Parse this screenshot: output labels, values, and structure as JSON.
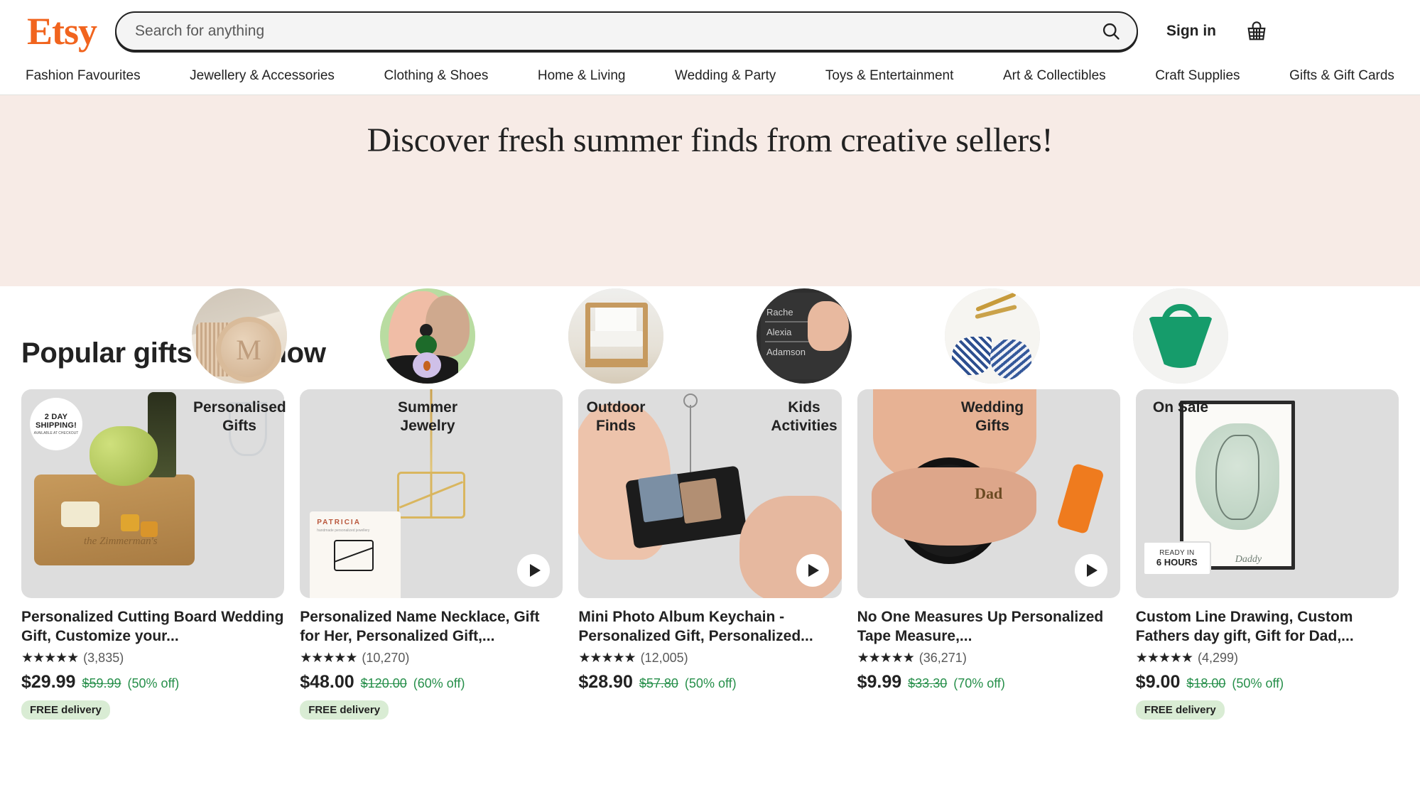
{
  "header": {
    "logo_text": "Etsy",
    "search_placeholder": "Search for anything",
    "search_value": "",
    "search_icon": "search-icon",
    "signin_label": "Sign in",
    "cart_icon": "shopping-basket-icon",
    "brand_color": "#f1641e"
  },
  "nav": {
    "items": [
      {
        "label": "Fashion Favourites"
      },
      {
        "label": "Jewellery & Accessories"
      },
      {
        "label": "Clothing & Shoes"
      },
      {
        "label": "Home & Living"
      },
      {
        "label": "Wedding & Party"
      },
      {
        "label": "Toys & Entertainment"
      },
      {
        "label": "Art & Collectibles"
      },
      {
        "label": "Craft Supplies"
      },
      {
        "label": "Gifts & Gift Cards"
      }
    ]
  },
  "banner": {
    "title": "Discover fresh summer finds from creative sellers!",
    "background_color": "#f7ebe6"
  },
  "categories": [
    {
      "label": "Personalised Gifts",
      "image": "monogram-stone-coaster-circle"
    },
    {
      "label": "Summer Jewelry",
      "image": "flower-earring-model-circle"
    },
    {
      "label": "Outdoor Finds",
      "image": "wooden-outdoor-chair-circle"
    },
    {
      "label": "Kids Activities",
      "image": "chalkboard-name-tracing-circle"
    },
    {
      "label": "Wedding Gifts",
      "image": "blue-patterned-favors-circle"
    },
    {
      "label": "On Sale",
      "image": "green-knot-bag-circle"
    }
  ],
  "main": {
    "section_title": "Popular gifts right now",
    "products": [
      {
        "title": "Personalized Cutting Board Wedding Gift, Customize your...",
        "rating_stars": "★★★★★",
        "review_count": "(3,835)",
        "price": "$29.99",
        "price_original": "$59.99",
        "discount": "(50% off)",
        "free_delivery": "FREE delivery",
        "has_free_delivery": true,
        "has_video": false,
        "shipping_badge": {
          "line1": "2 DAY",
          "line2": "SHIPPING!",
          "line3": "AVAILABLE AT CHECKOUT"
        },
        "image": "engraved-cheese-board-with-grapes-and-wine"
      },
      {
        "title": "Personalized Name Necklace, Gift for Her, Personalized Gift,...",
        "rating_stars": "★★★★★",
        "review_count": "(10,270)",
        "price": "$48.00",
        "price_original": "$120.00",
        "discount": "(60% off)",
        "free_delivery": "FREE delivery",
        "has_free_delivery": true,
        "has_video": true,
        "image": "gold-monogram-necklace-on-black"
      },
      {
        "title": "Mini Photo Album Keychain - Personalized Gift, Personalized...",
        "rating_stars": "★★★★★",
        "review_count": "(12,005)",
        "price": "$28.90",
        "price_original": "$57.80",
        "discount": "(50% off)",
        "free_delivery": "",
        "has_free_delivery": false,
        "has_video": true,
        "image": "hands-holding-mini-photo-album-keychain"
      },
      {
        "title": "No One Measures Up Personalized Tape Measure,...",
        "rating_stars": "★★★★★",
        "review_count": "(36,271)",
        "price": "$9.99",
        "price_original": "$33.30",
        "discount": "(70% off)",
        "free_delivery": "",
        "has_free_delivery": false,
        "has_video": true,
        "image": "hand-holding-engraved-dad-tape-measure"
      },
      {
        "title": "Custom Line Drawing, Custom Fathers day gift, Gift for Dad,...",
        "rating_stars": "★★★★★",
        "review_count": "(4,299)",
        "price": "$9.00",
        "price_original": "$18.00",
        "discount": "(50% off)",
        "free_delivery": "FREE delivery",
        "has_free_delivery": true,
        "has_video": false,
        "ready_badge": {
          "line1": "READY IN",
          "line2": "6 HOURS"
        },
        "caption": "Daddy",
        "image": "framed-custom-line-drawing-poster"
      }
    ]
  },
  "colors": {
    "accent": "#f1641e",
    "sale_green": "#268f4a",
    "badge_green_bg": "#d9ecd4",
    "banner_pink": "#f7ebe6",
    "text": "#222222",
    "muted": "#595959"
  }
}
